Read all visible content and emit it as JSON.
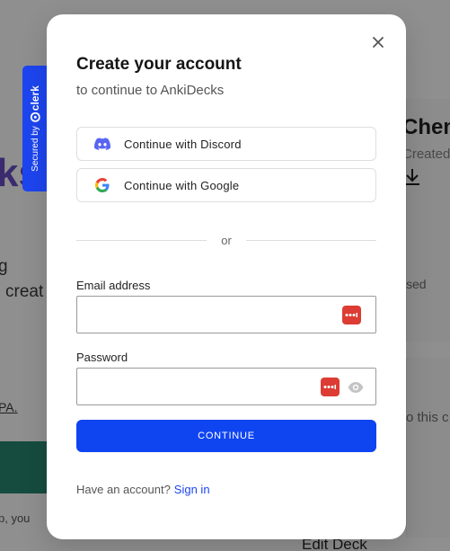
{
  "background": {
    "left_fragments": [
      "ks",
      "g",
      "creat",
      "PA.",
      "p, you"
    ],
    "right_fragments": [
      "Chem",
      "Created",
      "sed",
      "o this c",
      "Edit Deck"
    ]
  },
  "secured": {
    "text": "Secured by",
    "brand": "clerk",
    "color": "#1d45f0"
  },
  "modal": {
    "title": "Create your account",
    "subtitle": "to continue to AnkiDecks",
    "social": [
      {
        "label": "Continue with Discord",
        "icon": "discord-icon"
      },
      {
        "label": "Continue with Google",
        "icon": "google-icon"
      }
    ],
    "divider_text": "or",
    "email": {
      "label": "Email address",
      "value": ""
    },
    "password": {
      "label": "Password",
      "value": ""
    },
    "continue_label": "CONTINUE",
    "footer": {
      "prompt": "Have an account?",
      "link": "Sign in"
    },
    "accent": "#0f44f1"
  }
}
